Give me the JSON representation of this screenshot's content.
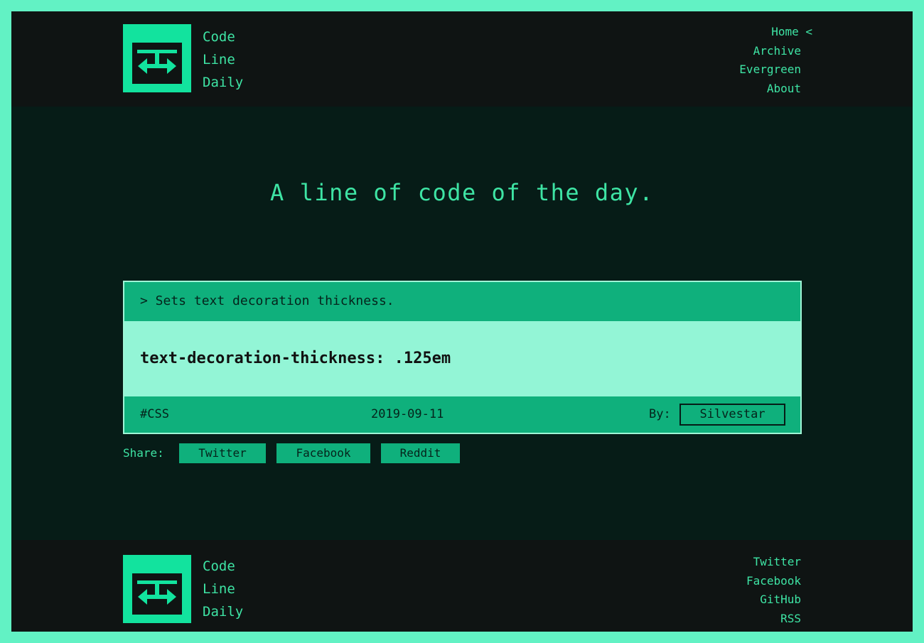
{
  "site": {
    "name_lines": [
      "Code",
      "Line",
      "Daily"
    ]
  },
  "nav": {
    "items": [
      {
        "label": "Home <"
      },
      {
        "label": "Archive"
      },
      {
        "label": "Evergreen"
      },
      {
        "label": "About"
      }
    ]
  },
  "hero": {
    "tagline": "A line of code of the day."
  },
  "card": {
    "description": "> Sets text decoration thickness.",
    "code": "text-decoration-thickness: .125em",
    "tag": "#CSS",
    "date": "2019-09-11",
    "by_label": "By:",
    "author": "Silvestar"
  },
  "share": {
    "label": "Share:",
    "buttons": [
      {
        "label": "Twitter"
      },
      {
        "label": "Facebook"
      },
      {
        "label": "Reddit"
      }
    ]
  },
  "footer": {
    "links": [
      {
        "label": "Twitter"
      },
      {
        "label": "Facebook"
      },
      {
        "label": "GitHub"
      },
      {
        "label": "RSS"
      }
    ]
  },
  "colors": {
    "outer_border": "#62f2c4",
    "header_bg": "#0f1413",
    "main_bg": "#061c17",
    "accent_text": "#3ee4a4",
    "card_bar": "#0fb07c",
    "code_bg": "#93f5d6"
  },
  "icons": {
    "logo": "code-brackets-logo-icon"
  }
}
